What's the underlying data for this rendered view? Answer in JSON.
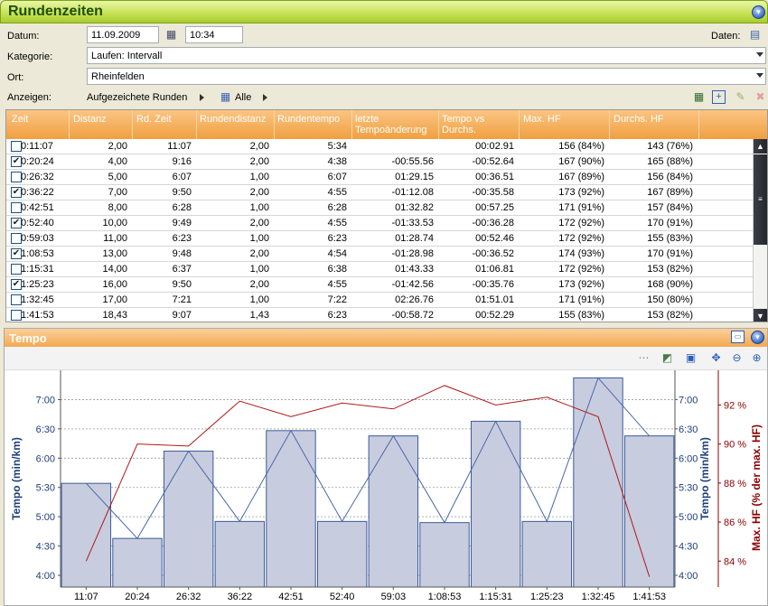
{
  "app": {
    "title": "Rundenzeiten"
  },
  "form": {
    "datum_label": "Datum:",
    "date_value": "11.09.2009",
    "time_value": "10:34",
    "daten_label": "Daten:",
    "kategorie_label": "Kategorie:",
    "kategorie_value": "Laufen: Intervall",
    "ort_label": "Ort:",
    "ort_value": "Rheinfelden",
    "anzeigen_label": "Anzeigen:",
    "laps_dropdown": "Aufgezeichete Runden",
    "filter_dropdown": "Alle"
  },
  "grid": {
    "columns": [
      "Zeit",
      "Distanz",
      "Rd. Zeit",
      "Rundendistanz",
      "Rundentempo",
      "letzte Tempoänderung",
      "Tempo vs Durchs.",
      "Max. HF",
      "Durchs. HF"
    ],
    "rows": [
      {
        "checked": false,
        "zeit": "0:11:07",
        "distanz": "2,00",
        "rdzeit": "11:07",
        "rdist": "2,00",
        "tempo": "5:34",
        "letzte": "",
        "vs": "00:02.91",
        "maxhf": "156 (84%)",
        "dhf": "143 (76%)"
      },
      {
        "checked": true,
        "zeit": "0:20:24",
        "distanz": "4,00",
        "rdzeit": "9:16",
        "rdist": "2,00",
        "tempo": "4:38",
        "letzte": "-00:55.56",
        "vs": "-00:52.64",
        "maxhf": "167 (90%)",
        "dhf": "165 (88%)"
      },
      {
        "checked": false,
        "zeit": "0:26:32",
        "distanz": "5,00",
        "rdzeit": "6:07",
        "rdist": "1,00",
        "tempo": "6:07",
        "letzte": "01:29.15",
        "vs": "00:36.51",
        "maxhf": "167 (89%)",
        "dhf": "156 (84%)"
      },
      {
        "checked": true,
        "zeit": "0:36:22",
        "distanz": "7,00",
        "rdzeit": "9:50",
        "rdist": "2,00",
        "tempo": "4:55",
        "letzte": "-01:12.08",
        "vs": "-00:35.58",
        "maxhf": "173 (92%)",
        "dhf": "167 (89%)"
      },
      {
        "checked": false,
        "zeit": "0:42:51",
        "distanz": "8,00",
        "rdzeit": "6:28",
        "rdist": "1,00",
        "tempo": "6:28",
        "letzte": "01:32.82",
        "vs": "00:57.25",
        "maxhf": "171 (91%)",
        "dhf": "157 (84%)"
      },
      {
        "checked": true,
        "zeit": "0:52:40",
        "distanz": "10,00",
        "rdzeit": "9:49",
        "rdist": "2,00",
        "tempo": "4:55",
        "letzte": "-01:33.53",
        "vs": "-00:36.28",
        "maxhf": "172 (92%)",
        "dhf": "170 (91%)"
      },
      {
        "checked": false,
        "zeit": "0:59:03",
        "distanz": "11,00",
        "rdzeit": "6:23",
        "rdist": "1,00",
        "tempo": "6:23",
        "letzte": "01:28.74",
        "vs": "00:52.46",
        "maxhf": "172 (92%)",
        "dhf": "155 (83%)"
      },
      {
        "checked": true,
        "zeit": "1:08:53",
        "distanz": "13,00",
        "rdzeit": "9:48",
        "rdist": "2,00",
        "tempo": "4:54",
        "letzte": "-01:28.98",
        "vs": "-00:36.52",
        "maxhf": "174 (93%)",
        "dhf": "170 (91%)"
      },
      {
        "checked": false,
        "zeit": "1:15:31",
        "distanz": "14,00",
        "rdzeit": "6:37",
        "rdist": "1,00",
        "tempo": "6:38",
        "letzte": "01:43.33",
        "vs": "01:06.81",
        "maxhf": "172 (92%)",
        "dhf": "153 (82%)"
      },
      {
        "checked": true,
        "zeit": "1:25:23",
        "distanz": "16,00",
        "rdzeit": "9:50",
        "rdist": "2,00",
        "tempo": "4:55",
        "letzte": "-01:42.56",
        "vs": "-00:35.76",
        "maxhf": "173 (92%)",
        "dhf": "168 (90%)"
      },
      {
        "checked": false,
        "zeit": "1:32:45",
        "distanz": "17,00",
        "rdzeit": "7:21",
        "rdist": "1,00",
        "tempo": "7:22",
        "letzte": "02:26.76",
        "vs": "01:51.01",
        "maxhf": "171 (91%)",
        "dhf": "150 (80%)"
      },
      {
        "checked": false,
        "zeit": "1:41:53",
        "distanz": "18,43",
        "rdzeit": "9:07",
        "rdist": "1,43",
        "tempo": "6:23",
        "letzte": "-00:58.72",
        "vs": "00:52.29",
        "maxhf": "155 (83%)",
        "dhf": "153 (82%)"
      }
    ]
  },
  "chart_panel": {
    "title": "Tempo"
  },
  "chart_data": {
    "type": "bar",
    "categories": [
      "11:07",
      "20:24",
      "26:32",
      "36:22",
      "42:51",
      "52:40",
      "59:03",
      "1:08:53",
      "1:15:31",
      "1:25:23",
      "1:32:45",
      "1:41:53"
    ],
    "ylabel": "Tempo (min/km)",
    "y2label": "Max. HF (% der max. HF)",
    "yticks": [
      "4:00",
      "4:30",
      "5:00",
      "5:30",
      "6:00",
      "6:30",
      "7:00"
    ],
    "y2ticks": [
      "84 %",
      "86 %",
      "88 %",
      "90 %",
      "92 %"
    ],
    "ylim_minutes": [
      3.8,
      7.5
    ],
    "y2lim": [
      82.67,
      93.78
    ],
    "series": [
      {
        "kind": "bar",
        "color": "#c8ccdf",
        "edge": "#3a5a9a",
        "values_minutes": [
          5.57,
          4.63,
          6.12,
          4.92,
          6.47,
          4.92,
          6.38,
          4.9,
          6.63,
          4.92,
          7.37,
          6.38
        ]
      },
      {
        "kind": "line",
        "color": "#4a68a8",
        "values_minutes": [
          5.57,
          4.63,
          6.12,
          4.92,
          6.47,
          4.92,
          6.38,
          4.9,
          6.63,
          4.92,
          7.37,
          6.38
        ]
      },
      {
        "kind": "line",
        "axis": "y2",
        "color": "#b01818",
        "values": [
          84.0,
          90.0,
          89.9,
          92.2,
          91.4,
          92.1,
          91.8,
          93.0,
          92.0,
          92.4,
          91.4,
          83.2
        ]
      }
    ],
    "grid": true
  }
}
